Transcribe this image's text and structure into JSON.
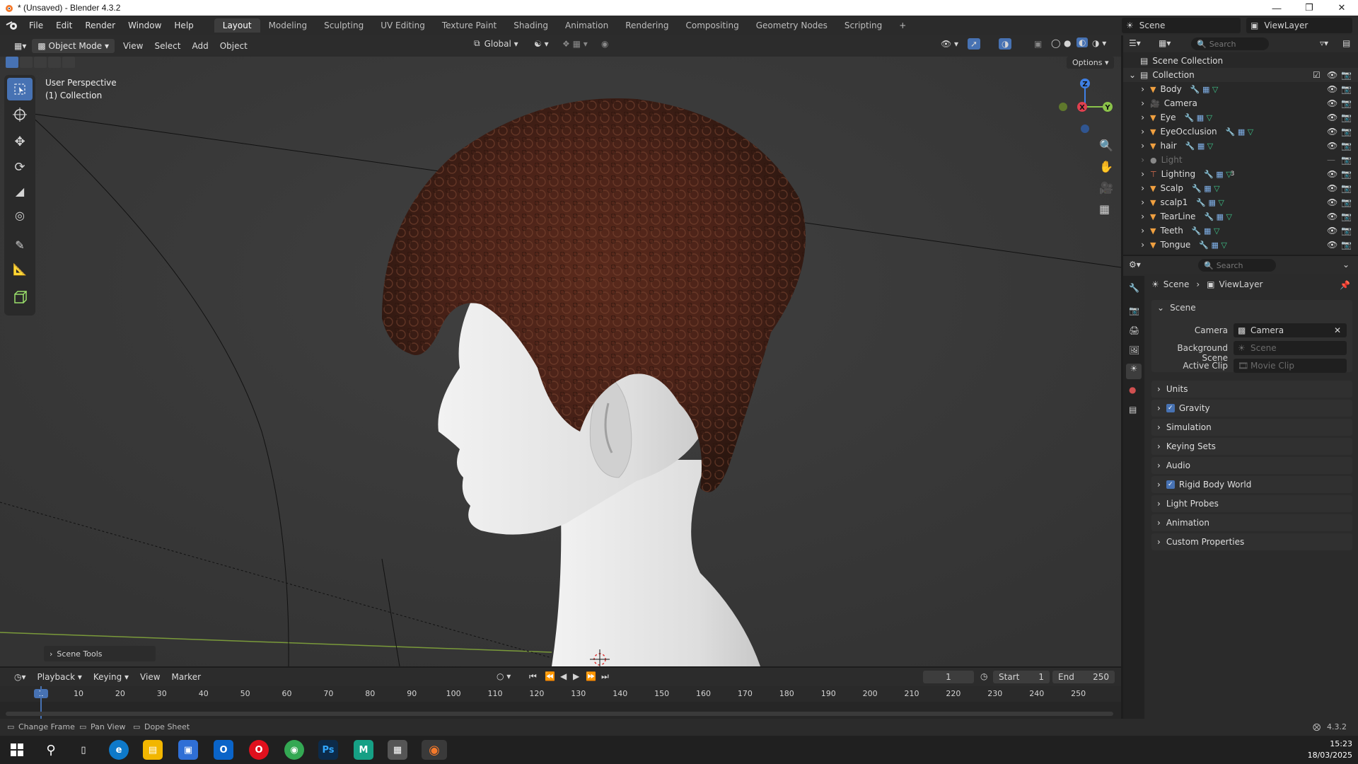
{
  "window": {
    "title": "* (Unsaved) - Blender 4.3.2"
  },
  "menu": [
    "File",
    "Edit",
    "Render",
    "Window",
    "Help"
  ],
  "workspaces": [
    "Layout",
    "Modeling",
    "Sculpting",
    "UV Editing",
    "Texture Paint",
    "Shading",
    "Animation",
    "Rendering",
    "Compositing",
    "Geometry Nodes",
    "Scripting"
  ],
  "scene_selector": "Scene",
  "viewlayer_selector": "ViewLayer",
  "viewport": {
    "mode": "Object Mode",
    "menus": [
      "View",
      "Select",
      "Add",
      "Object"
    ],
    "orientation": "Global",
    "options": "Options",
    "overlay_line1": "User Perspective",
    "overlay_line2": "(1) Collection",
    "scene_tools": "Scene Tools",
    "gizmo": {
      "z": "Z",
      "x": "X",
      "y": "Y"
    }
  },
  "outliner": {
    "search_placeholder": "Search",
    "root": "Scene Collection",
    "collection": "Collection",
    "items": [
      "Body",
      "Camera",
      "Eye",
      "EyeOcclusion",
      "hair",
      "Light",
      "Lighting",
      "Scalp",
      "scalp1",
      "TearLine",
      "Teeth",
      "Tongue"
    ],
    "lighting_badge": "3"
  },
  "properties": {
    "search_placeholder": "Search",
    "breadcrumb": [
      "Scene",
      "ViewLayer"
    ],
    "section": "Scene",
    "camera_label": "Camera",
    "camera_value": "Camera",
    "background_scene_label": "Background Scene",
    "background_scene_placeholder": "Scene",
    "active_clip_label": "Active Clip",
    "active_clip_placeholder": "Movie Clip",
    "panels": [
      "Units",
      "Gravity",
      "Simulation",
      "Keying Sets",
      "Audio",
      "Rigid Body World",
      "Light Probes",
      "Animation",
      "Custom Properties"
    ]
  },
  "timeline": {
    "menus": [
      "Playback",
      "Keying",
      "View",
      "Marker"
    ],
    "current_frame": "1",
    "start_label": "Start",
    "start_value": "1",
    "end_label": "End",
    "end_value": "250",
    "ticks": [
      "1",
      "10",
      "20",
      "30",
      "40",
      "50",
      "60",
      "70",
      "80",
      "90",
      "100",
      "110",
      "120",
      "130",
      "140",
      "150",
      "160",
      "170",
      "180",
      "190",
      "200",
      "210",
      "220",
      "230",
      "240",
      "250"
    ]
  },
  "statusbar": {
    "hints": [
      "Change Frame",
      "Pan View",
      "Dope Sheet"
    ],
    "version": "4.3.2"
  },
  "taskbar": {
    "time": "15:23",
    "date": "18/03/2025"
  },
  "colors": {
    "accent": "#4772b3",
    "bg": "#3a3a3a",
    "panel": "#2b2b2b",
    "axis_x": "#e0404f",
    "axis_y": "#8bc34a",
    "axis_z": "#3f80e6"
  }
}
